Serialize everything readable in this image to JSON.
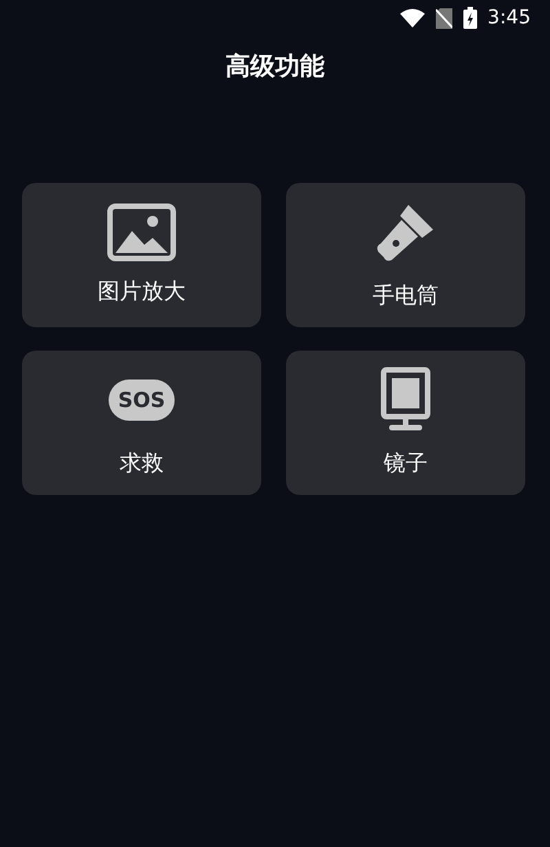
{
  "status_bar": {
    "time": "3:45"
  },
  "title": "高级功能",
  "tiles": [
    {
      "kind": "image",
      "label": "图片放大"
    },
    {
      "kind": "flashlight",
      "label": "手电筒"
    },
    {
      "kind": "sos",
      "label": "求救",
      "badge": "SOS"
    },
    {
      "kind": "mirror",
      "label": "镜子"
    }
  ]
}
